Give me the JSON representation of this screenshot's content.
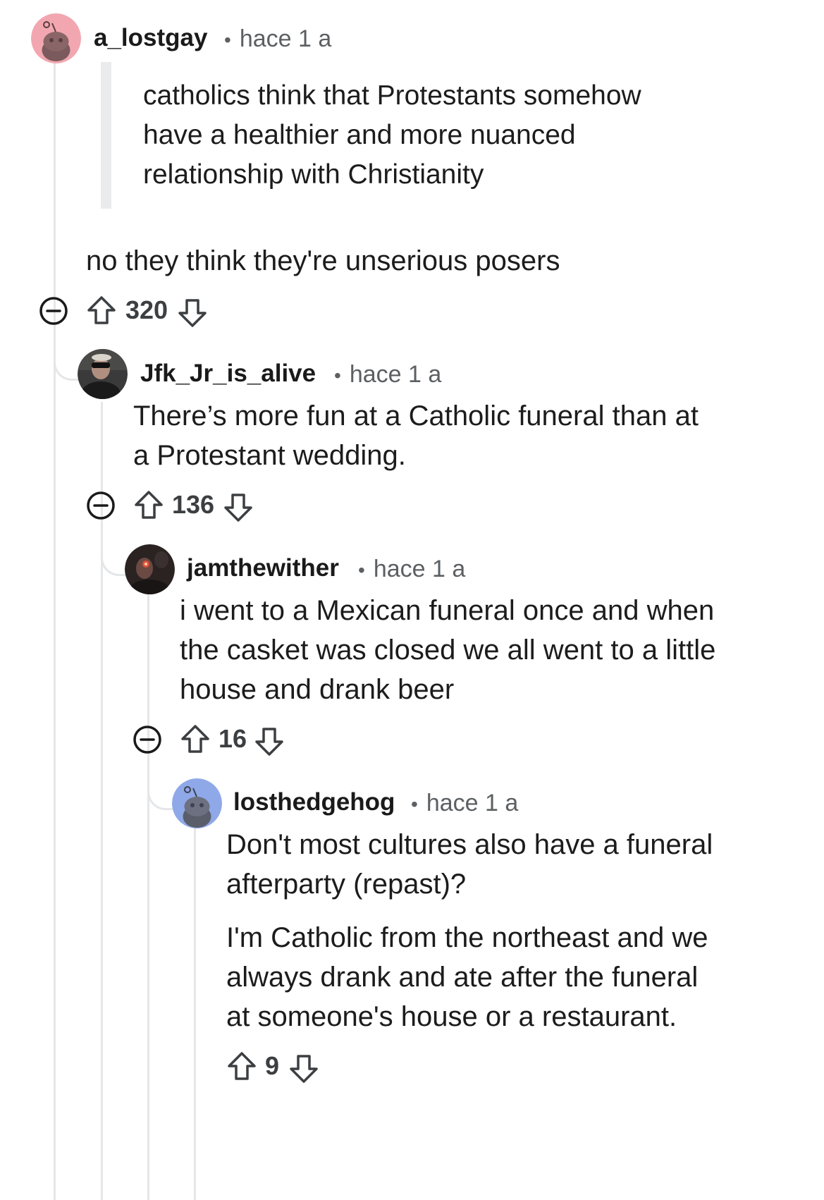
{
  "comments": [
    {
      "username": "a_lostgay",
      "time": "hace 1 a",
      "avatar": "pink-snoo-avatar",
      "quote": "catholics think that Protestants somehow have a healthier and more nuanced relationship with Christianity",
      "quote_lines": [
        "catholics think that Protestants somehow",
        "have a healthier and more nuanced",
        "relationship with Christianity"
      ],
      "text_lines": [
        "no they think they're unserious posers"
      ],
      "score": "320"
    },
    {
      "username": "Jfk_Jr_is_alive",
      "time": "hace 1 a",
      "avatar": "man-with-sunglasses-avatar",
      "text_lines": [
        "There’s more fun at a Catholic funeral than at",
        "a Protestant wedding."
      ],
      "score": "136"
    },
    {
      "username": "jamthewither",
      "time": "hace 1 a",
      "avatar": "dark-photo-avatar",
      "text_lines": [
        "i went to a Mexican funeral once and when",
        "the casket was closed we all went to a little",
        "house and drank beer"
      ],
      "score": "16"
    },
    {
      "username": "losthedgehog",
      "time": "hace 1 a",
      "avatar": "blue-snoo-avatar",
      "paragraph1_lines": [
        "Don't most cultures also have a funeral",
        "afterparty (repast)?"
      ],
      "paragraph2_lines": [
        "I'm Catholic from the northeast and we",
        "always drank and ate after the funeral",
        "at someone's house or a restaurant."
      ],
      "score": "9"
    }
  ],
  "colors": {
    "thread_line": "#e4e6e8",
    "pink_avatar_bg": "#f2a7b0",
    "blue_avatar_bg": "#8fa8e8",
    "text": "#1c1c1c",
    "meta": "#5c6063"
  },
  "icons": [
    "collapse-icon",
    "upvote-icon",
    "downvote-icon"
  ]
}
